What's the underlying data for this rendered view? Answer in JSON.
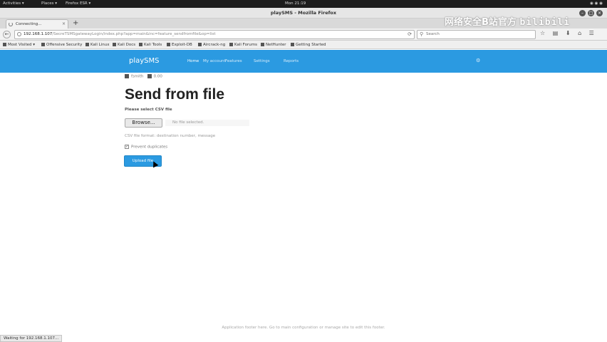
{
  "os_topbar": {
    "activities": "Activities ▾",
    "places": "Places ▾",
    "app": "Firefox ESR ▾",
    "clock": "Mon 21:19",
    "tray": "◉ ◉ ◉"
  },
  "browser": {
    "window_title": "playSMS - Mozilla Firefox",
    "tab": {
      "label": "Connecting..."
    },
    "url": {
      "host": "192.168.1.107",
      "path": "/SecreTSMSgatewayLogin/index.php?app=main&inc=feature_sendfromfile&op=list"
    },
    "search_placeholder": "Search",
    "nav_icons": "☆ ▤ ⬇ ⌂ ☰",
    "bookmarks": [
      "Most Visited ▾",
      "Offensive Security",
      "Kali Linux",
      "Kali Docs",
      "Kali Tools",
      "Exploit-DB",
      "Aircrack-ng",
      "Kali Forums",
      "NetHunter",
      "Getting Started"
    ]
  },
  "watermark": {
    "text": "网络安全B站官方",
    "logo": "bilibili"
  },
  "app": {
    "brand": "playSMS",
    "menu": [
      "Home",
      "My account",
      "Features",
      "Settings",
      "Reports"
    ],
    "user_name": "fsmith",
    "credit": "0.00",
    "page_title": "Send from file",
    "file_label": "Please select CSV file",
    "browse_label": "Browse...",
    "file_status": "No file selected.",
    "format_hint": "CSV file format: destination number, message",
    "duplicates_label": "Prevent duplicates",
    "upload_label": "Upload file",
    "footer": "Application footer here. Go to main configuration or manage site to edit this footer."
  },
  "status_bar": "Waiting for 192.168.1.107..."
}
